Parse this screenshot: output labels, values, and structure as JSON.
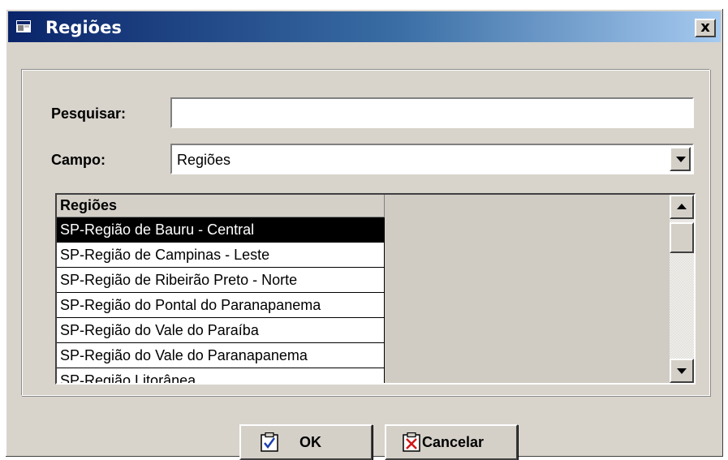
{
  "window": {
    "title": "Regiões",
    "close_label": "x"
  },
  "form": {
    "search_label": "Pesquisar:",
    "search_value": "",
    "field_label": "Campo:",
    "field_value": "Regiões"
  },
  "grid": {
    "column_header": "Regiões",
    "rows": [
      "SP-Região de Bauru - Central",
      "SP-Região de Campinas - Leste",
      "SP-Região de Ribeirão Preto - Norte",
      "SP-Região do Pontal do Paranapanema",
      "SP-Região do Vale do Paraíba",
      "SP-Região do Vale do Paranapanema",
      "SP-Região Litorânea"
    ],
    "selected_index": 0
  },
  "buttons": {
    "ok_label": "OK",
    "cancel_label": "Cancelar"
  },
  "icons": {
    "title": "window-app-icon",
    "ok": "checkmark-clipboard-icon",
    "cancel": "x-clipboard-icon"
  },
  "colors": {
    "title_gradient_start": "#0a246a",
    "title_gradient_end": "#a6caf0",
    "selection_bg": "#000000",
    "face": "#d4d0c8"
  }
}
